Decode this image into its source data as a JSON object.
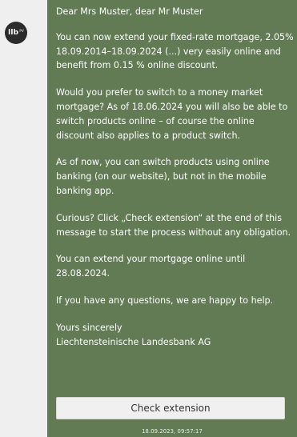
{
  "avatar": {
    "label": "llb",
    "superscript": "PV"
  },
  "message": {
    "greeting": "Dear Mrs Muster, dear Mr Muster",
    "paragraphs": [
      "You can now extend your fixed-rate mortgage, 2.05% 18.09.2014–18.09.2024 (...) very easily online and benefit from 0.15 % online discount.",
      "Would you prefer to switch to a money market mortgage? As of 18.06.2024 you will also be able to switch products online – of course the online discount also applies to a product switch.",
      "As of now, you can switch products using online banking (on our website), but not in the mobile banking app.",
      "Curious? Click „Check extension“ at the end of this message to start the process without any obligation.",
      "You can extend your mortgage online until 28.08.2024.",
      "If you have any questions, we are happy to help."
    ],
    "closing": "Yours sincerely",
    "sender": "Liechtensteinische Landesbank AG"
  },
  "button": {
    "label": "Check extension"
  },
  "timestamp": "18.09.2023, 09:57:17",
  "colors": {
    "bubble": "#627b55",
    "strip": "#efefef",
    "avatar": "#2b2b2b",
    "button": "#f0f0f0"
  }
}
